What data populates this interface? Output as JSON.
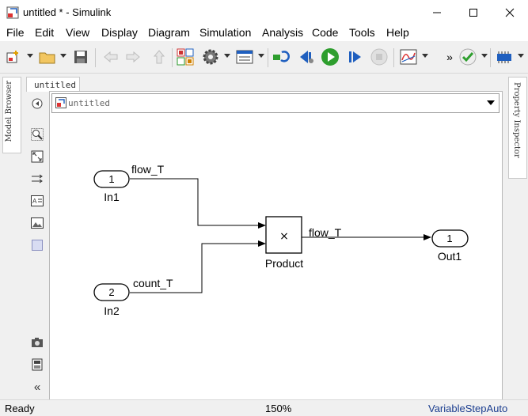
{
  "window": {
    "title": "untitled * - Simulink"
  },
  "menu": [
    "File",
    "Edit",
    "View",
    "Display",
    "Diagram",
    "Simulation",
    "Analysis",
    "Code",
    "Tools",
    "Help"
  ],
  "sidebar": {
    "left_tab": "Model Browser",
    "right_tab": "Property Inspector"
  },
  "document": {
    "tab_label": "untitled",
    "address": "untitled"
  },
  "diagram": {
    "in1": {
      "number": "1",
      "name": "In1",
      "signal": "flow_T"
    },
    "in2": {
      "number": "2",
      "name": "In2",
      "signal": "count_T"
    },
    "product": {
      "symbol": "×",
      "name": "Product",
      "signal": "flow_T"
    },
    "out1": {
      "number": "1",
      "name": "Out1"
    }
  },
  "status": {
    "left": "Ready",
    "zoom": "150%",
    "solver": "VariableStepAuto"
  },
  "colors": {
    "run_green": "#2e9e2e",
    "status_solver": "#1a3d8f"
  }
}
